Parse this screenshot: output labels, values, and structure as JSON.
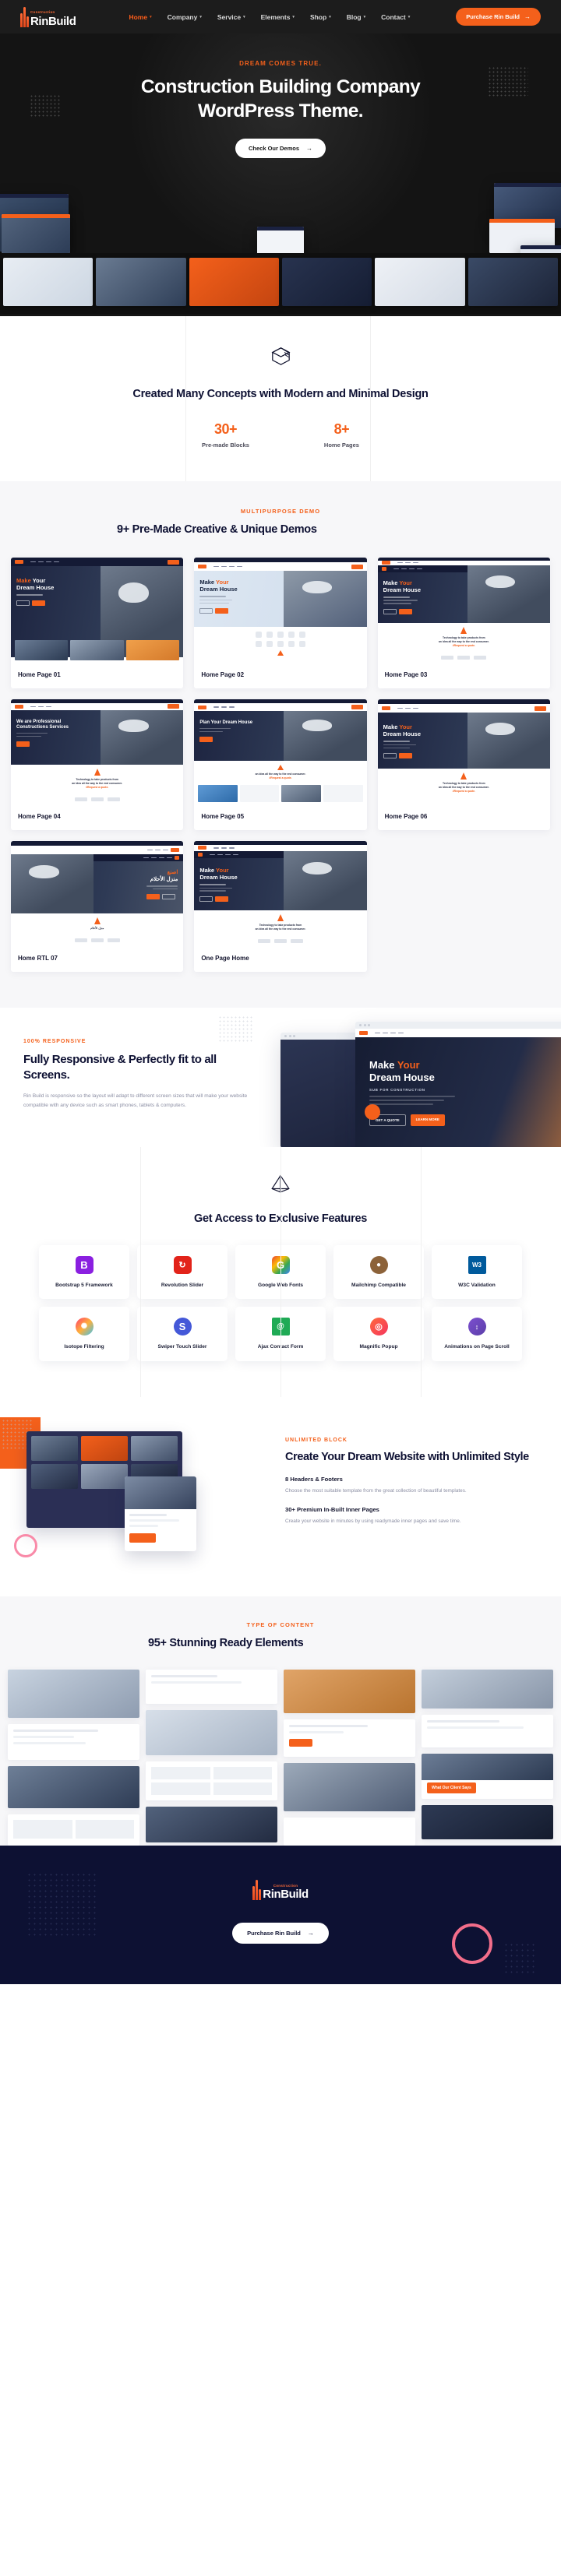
{
  "brand": {
    "sub": "Construction",
    "name": "RinBuild",
    "name_prefix": "R",
    "name_suffix": "Build"
  },
  "header": {
    "nav": [
      {
        "label": "Home",
        "active": true
      },
      {
        "label": "Company",
        "active": false
      },
      {
        "label": "Service",
        "active": false
      },
      {
        "label": "Elements",
        "active": false
      },
      {
        "label": "Shop",
        "active": false
      },
      {
        "label": "Blog",
        "active": false
      },
      {
        "label": "Contact",
        "active": false
      }
    ],
    "cta": "Purchase Rin Build",
    "caret": "▾",
    "arrow": "→"
  },
  "hero": {
    "eyebrow": "DREAM COMES TRUE.",
    "title_line1": "Construction Building Company",
    "title_line2": "WordPress Theme.",
    "button": "Check Our Demos",
    "arrow": "→"
  },
  "concepts": {
    "icon": "cube-icon",
    "title": "Created Many Concepts with Modern and Minimal Design",
    "stats": [
      {
        "value": "30+",
        "label": "Pre-made Blocks"
      },
      {
        "value": "8+",
        "label": "Home Pages"
      }
    ]
  },
  "demos": {
    "eyebrow": "MULTIPURPOSE DEMO",
    "title": "9+ Pre-Made Creative & Unique Demos",
    "cards": [
      {
        "label": "Home Page 01"
      },
      {
        "label": "Home Page 02"
      },
      {
        "label": "Home Page 03"
      },
      {
        "label": "Home Page 04"
      },
      {
        "label": "Home Page 05"
      },
      {
        "label": "Home Page 06"
      },
      {
        "label": "Home RTL 07"
      },
      {
        "label": "One Page Home"
      }
    ],
    "demo_headline_make": "Make",
    "demo_headline_your": "Your",
    "demo_headline_dream": "Dream House",
    "demo_sub": "SUB FOR CONSTRUCTION",
    "demo_footer_line1": "Technology to take products from",
    "demo_footer_line2": "an idea all the way to the end consumer.",
    "demo_footer_link": "#Request a quote.",
    "demo_ar_line1": "اصنع",
    "demo_ar_line2": "منزل الأحلام"
  },
  "responsive": {
    "eyebrow": "100% RESPONSIVE",
    "title": "Fully Responsive & Perfectly fit to all Screens.",
    "body": "Rin Build is responsive so the layout will adapt to different screen sizes that will make your website compatible with any device such as smart phones, tablets & computers.",
    "mock_title_make": "Make",
    "mock_title_your": "Your",
    "mock_title_dream": "Dream House",
    "mock_sub": "SUB FOR CONSTRUCTION",
    "mock_btn1": "GET A QUOTE",
    "mock_btn2": "LEARN MORE"
  },
  "features": {
    "icon": "pyramid-icon",
    "title": "Get Access to Exclusive Features",
    "items": [
      {
        "label": "Bootstrap 5 Framework",
        "glyph": "B",
        "color": "#8a1fe0",
        "icon": "bootstrap-icon"
      },
      {
        "label": "Revolution Slider",
        "glyph": "↻",
        "color": "#e2231a",
        "icon": "revolution-slider-icon"
      },
      {
        "label": "Google Web Fonts",
        "glyph": "G",
        "color": "#ffffff",
        "icon": "google-icon"
      },
      {
        "label": "Mailchimp Compatible",
        "glyph": "●",
        "color": "#8c6239",
        "icon": "mailchimp-icon"
      },
      {
        "label": "W3C Validation",
        "glyph": "W3",
        "color": "#005a9c",
        "icon": "w3c-icon"
      },
      {
        "label": "Isotope Filtering",
        "glyph": "✺",
        "color": "#ff8a3d",
        "icon": "isotope-icon"
      },
      {
        "label": "Swiper Touch Slider",
        "glyph": "S",
        "color": "#4458d8",
        "icon": "swiper-icon"
      },
      {
        "label": "Ajax Contact Form",
        "glyph": "@",
        "color": "#1faa55",
        "icon": "ajax-contact-form-icon"
      },
      {
        "label": "Magnific Popup",
        "glyph": "◎",
        "color": "#f5355e",
        "icon": "magnific-popup-icon"
      },
      {
        "label": "Animations on Page Scroll",
        "glyph": "↕",
        "color": "#6f4bc4",
        "icon": "animations-icon"
      }
    ]
  },
  "unlimited": {
    "eyebrow": "UNLIMITED BLOCK",
    "title": "Create Your Dream Website with Unlimited Style",
    "items": [
      {
        "heading": "8 Headers & Footers",
        "body": "Choose the most suitable template from the great collection of beautiful templates."
      },
      {
        "heading": "30+ Premium In-Built Inner Pages",
        "body": "Create your website in minutes by using readymade inner pages and save time."
      }
    ]
  },
  "elements": {
    "eyebrow": "TYPE OF CONTENT",
    "title": "95+ Stunning Ready Elements",
    "card_caption": "What Our Client Says"
  },
  "footer": {
    "cta": "Purchase Rin Build",
    "arrow": "→"
  },
  "colors": {
    "accent": "#f4601b",
    "dark": "#0d1133",
    "header_bg": "#1c1c1c",
    "pink": "#f98aa8"
  }
}
